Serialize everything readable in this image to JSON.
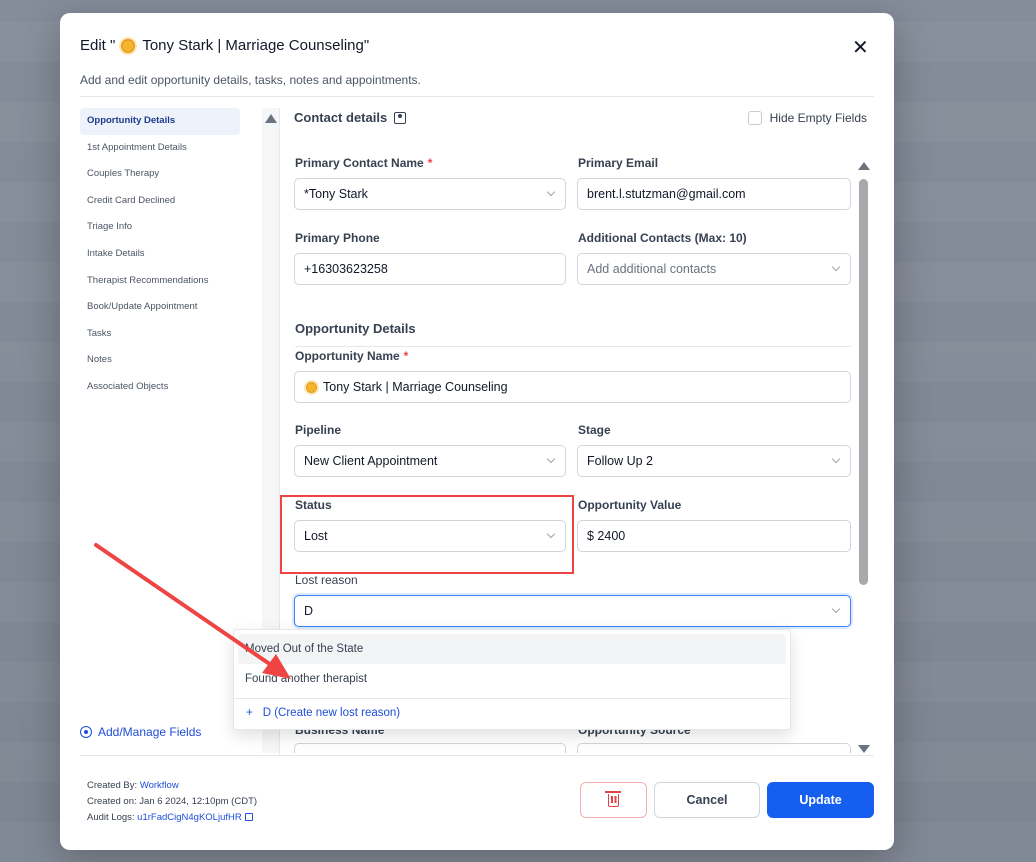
{
  "modal": {
    "title_prefix": "Edit \"",
    "title_name": " Tony Stark | Marriage Counseling\"",
    "subtitle": "Add and edit opportunity details, tasks, notes and appointments.",
    "close_icon": "close-icon"
  },
  "nav": {
    "items": [
      {
        "label": "Opportunity Details",
        "active": true
      },
      {
        "label": "1st Appointment Details"
      },
      {
        "label": "Couples Therapy"
      },
      {
        "label": "Credit Card Declined"
      },
      {
        "label": "Triage Info"
      },
      {
        "label": "Intake Details"
      },
      {
        "label": "Therapist Recommendations"
      },
      {
        "label": "Book/Update Appointment"
      },
      {
        "label": "Tasks"
      },
      {
        "label": "Notes"
      },
      {
        "label": "Associated Objects"
      }
    ],
    "manage_fields": "Add/Manage Fields"
  },
  "contact_section": {
    "title": "Contact details",
    "hide_empty_label": "Hide Empty Fields",
    "primary_contact_label": "Primary Contact Name",
    "primary_contact_value": "*Tony Stark",
    "primary_email_label": "Primary Email",
    "primary_email_value": "brent.l.stutzman@gmail.com",
    "primary_phone_label": "Primary Phone",
    "primary_phone_value": "+16303623258",
    "additional_contacts_label": "Additional Contacts (Max: 10)",
    "additional_contacts_placeholder": "Add additional contacts"
  },
  "opportunity_section": {
    "title": "Opportunity Details",
    "name_label": "Opportunity Name",
    "name_value": "Tony Stark | Marriage Counseling",
    "pipeline_label": "Pipeline",
    "pipeline_value": "New Client Appointment",
    "stage_label": "Stage",
    "stage_value": "Follow Up 2",
    "status_label": "Status",
    "status_value": "Lost",
    "value_label": "Opportunity Value",
    "value_value": "$ 2400",
    "lost_reason_label": "Lost reason",
    "lost_reason_value": "D",
    "business_name_label": "Business Name",
    "opportunity_source_label": "Opportunity Source"
  },
  "lost_reason_dropdown": {
    "options": [
      "Moved Out of the State",
      "Found another therapist"
    ],
    "create_label": "D (Create new lost reason)"
  },
  "footer": {
    "created_by_label": "Created By: ",
    "created_by_value": "Workflow",
    "created_on": "Created on: Jan 6 2024, 12:10pm (CDT)",
    "audit_label": "Audit Logs: ",
    "audit_value": "u1rFadCigN4gKOLjufHR",
    "cancel": "Cancel",
    "update": "Update"
  },
  "colors": {
    "primary": "#155eef",
    "annotation": "#ef4444"
  }
}
